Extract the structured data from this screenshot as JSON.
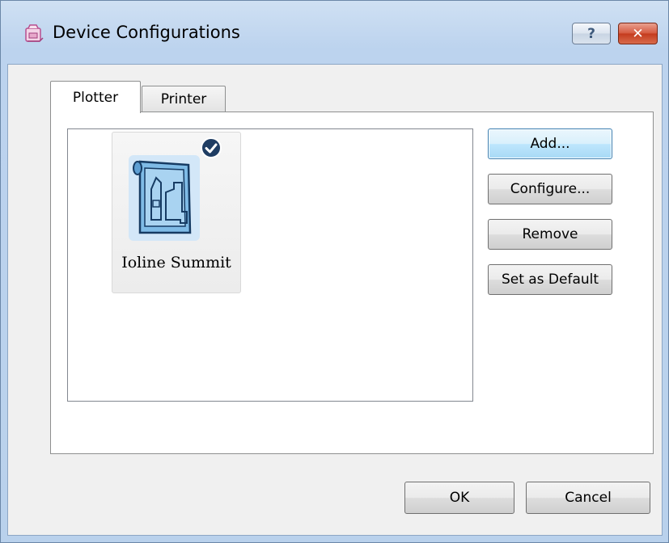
{
  "window": {
    "title": "Device Configurations",
    "help_symbol": "?",
    "close_symbol": "✕",
    "app_icon": "app-icon"
  },
  "tabs": [
    {
      "label": "Plotter",
      "selected": true
    },
    {
      "label": "Printer",
      "selected": false
    }
  ],
  "device_list": {
    "items": [
      {
        "name": "Ioline Summit",
        "icon": "plotter-icon",
        "is_default": true
      }
    ]
  },
  "side_buttons": {
    "add": "Add...",
    "configure": "Configure...",
    "remove": "Remove",
    "set_default": "Set as Default"
  },
  "footer": {
    "ok": "OK",
    "cancel": "Cancel"
  },
  "colors": {
    "accent": "#1e6fb4",
    "selection_tint": "#cfe6f8"
  }
}
